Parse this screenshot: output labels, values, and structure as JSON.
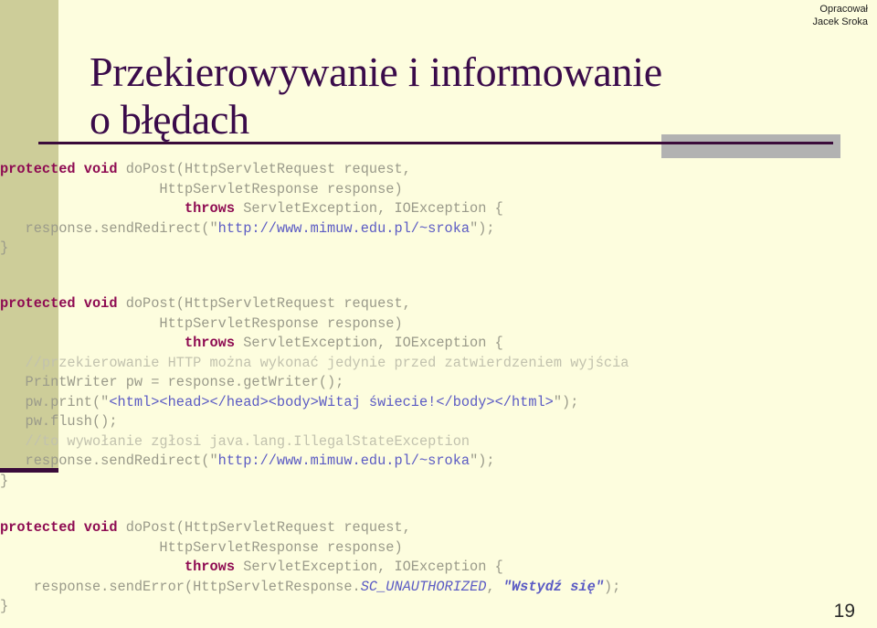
{
  "slide": {
    "page_number": "19",
    "colors": {
      "background": "#FDFDDE",
      "sidebar": "#CDCD99",
      "accent_rule": "#3A0B3A",
      "gray_block": "#B2B2B2",
      "title": "#3A0B4A",
      "keyword": "#8E0B52",
      "string": "#5B5BC4",
      "comment": "#C2C2AE",
      "code_plain": "#9A9A8A"
    }
  },
  "author": {
    "line1": "Opracował",
    "line2": "Jacek Sroka"
  },
  "title": {
    "line1": "Przekierowywanie i informowanie",
    "line2": "o błędach"
  },
  "code_blocks": [
    {
      "id": "block-1",
      "lines": [
        [
          {
            "text": "protected void",
            "style": "kw"
          },
          {
            "text": " doPost(HttpServletRequest request,",
            "style": "plain"
          }
        ],
        [
          {
            "text": "                   HttpServletResponse response)",
            "style": "plain"
          }
        ],
        [
          {
            "text": "                      ",
            "style": "plain"
          },
          {
            "text": "throws",
            "style": "kw"
          },
          {
            "text": " ServletException, IOException {",
            "style": "plain"
          }
        ],
        [
          {
            "text": "   response.sendRedirect(\"",
            "style": "plain"
          },
          {
            "text": "http://www.mimuw.edu.pl/~sroka",
            "style": "str"
          },
          {
            "text": "\");",
            "style": "plain"
          }
        ],
        [
          {
            "text": "}",
            "style": "plain"
          }
        ]
      ]
    },
    {
      "id": "block-2",
      "lines": [
        [
          {
            "text": "protected void",
            "style": "kw"
          },
          {
            "text": " doPost(HttpServletRequest request,",
            "style": "plain"
          }
        ],
        [
          {
            "text": "                   HttpServletResponse response)",
            "style": "plain"
          }
        ],
        [
          {
            "text": "                      ",
            "style": "plain"
          },
          {
            "text": "throws",
            "style": "kw"
          },
          {
            "text": " ServletException, IOException {",
            "style": "plain"
          }
        ],
        [
          {
            "text": "   //przekierowanie HTTP można wykonać jedynie przed zatwierdzeniem wyjścia",
            "style": "cmt"
          }
        ],
        [
          {
            "text": "   PrintWriter pw = response.getWriter();",
            "style": "plain"
          }
        ],
        [
          {
            "text": "   pw.print(\"",
            "style": "plain"
          },
          {
            "text": "<html><head></head><body>Witaj świecie!</body></html>",
            "style": "str"
          },
          {
            "text": "\");",
            "style": "plain"
          }
        ],
        [
          {
            "text": "   pw.flush();",
            "style": "plain"
          }
        ],
        [
          {
            "text": "   //to wywołanie zgłosi java.lang.IllegalStateException",
            "style": "cmt"
          }
        ],
        [
          {
            "text": "   response.sendRedirect(\"",
            "style": "plain"
          },
          {
            "text": "http://www.mimuw.edu.pl/~sroka",
            "style": "str"
          },
          {
            "text": "\");",
            "style": "plain"
          }
        ],
        [
          {
            "text": "}",
            "style": "plain"
          }
        ]
      ]
    },
    {
      "id": "block-3",
      "lines": [
        [
          {
            "text": "protected void",
            "style": "kw"
          },
          {
            "text": " doPost(HttpServletRequest request,",
            "style": "plain"
          }
        ],
        [
          {
            "text": "                   HttpServletResponse response)",
            "style": "plain"
          }
        ],
        [
          {
            "text": "                      ",
            "style": "plain"
          },
          {
            "text": "throws",
            "style": "kw"
          },
          {
            "text": " ServletException, IOException {",
            "style": "plain"
          }
        ],
        [
          {
            "text": "    response.sendError(HttpServletResponse.",
            "style": "plain"
          },
          {
            "text": "SC_UNAUTHORIZED",
            "style": "const"
          },
          {
            "text": ", ",
            "style": "plain"
          },
          {
            "text": "\"Wstydź się\"",
            "style": "strit"
          },
          {
            "text": ");",
            "style": "plain"
          }
        ],
        [
          {
            "text": "}",
            "style": "plain"
          }
        ]
      ]
    }
  ]
}
